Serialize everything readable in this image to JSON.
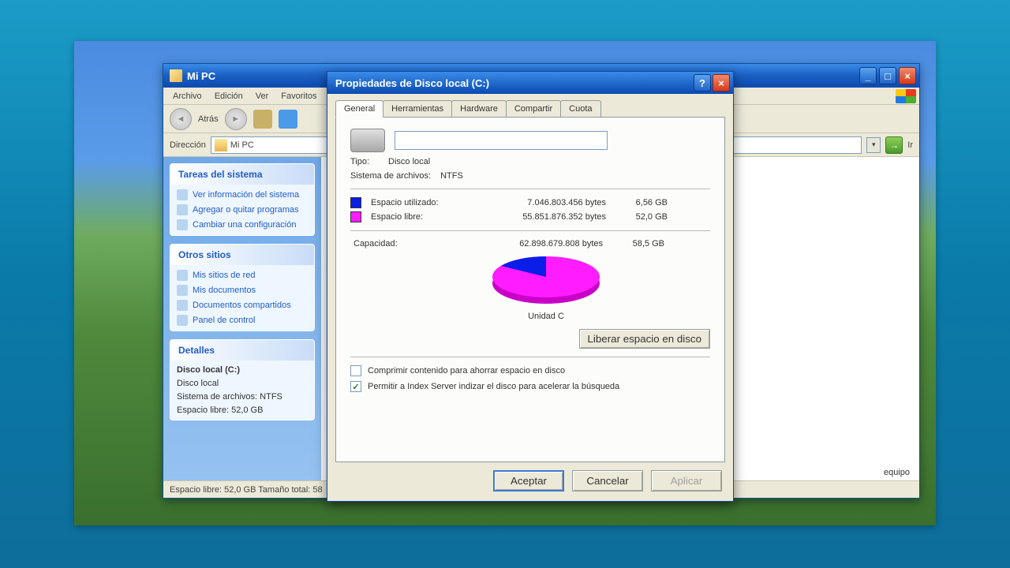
{
  "explorer": {
    "title": "Mi PC",
    "menu": [
      "Archivo",
      "Edición",
      "Ver",
      "Favoritos"
    ],
    "back_label": "Atrás",
    "address_label": "Dirección",
    "address_value": "Mi PC",
    "go_label": "Ir",
    "sidebar": {
      "tasks_header": "Tareas del sistema",
      "tasks": [
        "Ver información del sistema",
        "Agregar o quitar programas",
        "Cambiar una configuración"
      ],
      "other_header": "Otros sitios",
      "other": [
        "Mis sitios de red",
        "Mis documentos",
        "Documentos compartidos",
        "Panel de control"
      ],
      "details_header": "Detalles",
      "details_title": "Disco local (C:)",
      "details_lines": [
        "Disco local",
        "Sistema de archivos: NTFS",
        "Espacio libre: 52,0 GB"
      ]
    },
    "status": "Espacio libre: 52,0 GB Tamaño total: 58",
    "content_tail": "equipo"
  },
  "dialog": {
    "title": "Propiedades de Disco local (C:)",
    "tabs": [
      "General",
      "Herramientas",
      "Hardware",
      "Compartir",
      "Cuota"
    ],
    "type_label": "Tipo:",
    "type_value": "Disco local",
    "fs_label": "Sistema de archivos:",
    "fs_value": "NTFS",
    "used_label": "Espacio utilizado:",
    "used_bytes": "7.046.803.456 bytes",
    "used_gb": "6,56 GB",
    "free_label": "Espacio libre:",
    "free_bytes": "55.851.876.352 bytes",
    "free_gb": "52,0 GB",
    "capacity_label": "Capacidad:",
    "capacity_bytes": "62.898.679.808 bytes",
    "capacity_gb": "58,5 GB",
    "drive_label": "Unidad C",
    "cleanup_button": "Liberar espacio en disco",
    "compress_label": "Comprimir contenido para ahorrar espacio en disco",
    "index_label": "Permitir a Index Server indizar el disco para acelerar la búsqueda",
    "ok": "Aceptar",
    "cancel": "Cancelar",
    "apply": "Aplicar"
  },
  "colors": {
    "used": "#0a1ee8",
    "free": "#ff1cff"
  },
  "chart_data": {
    "type": "pie",
    "title": "Unidad C",
    "series": [
      {
        "name": "Espacio utilizado",
        "value_bytes": 7046803456,
        "value_gb": 6.56,
        "color": "#0a1ee8"
      },
      {
        "name": "Espacio libre",
        "value_bytes": 55851876352,
        "value_gb": 52.0,
        "color": "#ff1cff"
      }
    ],
    "total_bytes": 62898679808,
    "total_gb": 58.5
  }
}
